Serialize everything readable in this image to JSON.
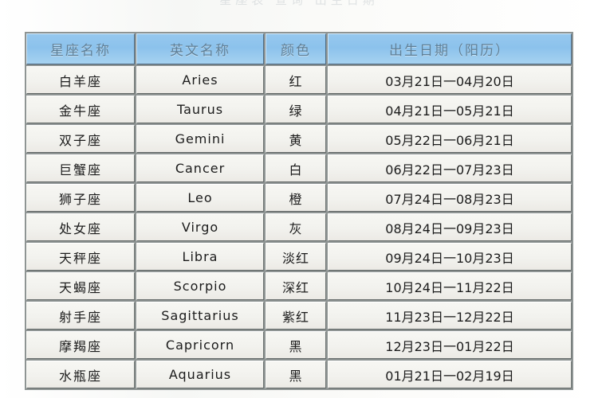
{
  "page": {
    "top_faint_text": "星座表 查询 出生日期"
  },
  "table": {
    "headers": [
      "星座名称",
      "英文名称",
      "颜色",
      "出生日期（阳历）"
    ],
    "rows": [
      {
        "name": "白羊座",
        "english": "Aries",
        "color": "红",
        "dates": "03月21日一04月20日"
      },
      {
        "name": "金牛座",
        "english": "Taurus",
        "color": "绿",
        "dates": "04月21日一05月21日"
      },
      {
        "name": "双子座",
        "english": "Gemini",
        "color": "黄",
        "dates": "05月22日一06月21日"
      },
      {
        "name": "巨蟹座",
        "english": "Cancer",
        "color": "白",
        "dates": "06月22日一07月23日"
      },
      {
        "name": "狮子座",
        "english": "Leo",
        "color": "橙",
        "dates": "07月24日一08月23日"
      },
      {
        "name": "处女座",
        "english": "Virgo",
        "color": "灰",
        "dates": "08月24日一09月23日"
      },
      {
        "name": "天秤座",
        "english": "Libra",
        "color": "淡红",
        "dates": "09月24日一10月23日"
      },
      {
        "name": "天蝎座",
        "english": "Scorpio",
        "color": "深红",
        "dates": "10月24日一11月22日"
      },
      {
        "name": "射手座",
        "english": "Sagittarius",
        "color": "紫红",
        "dates": "11月23日一12月22日"
      },
      {
        "name": "摩羯座",
        "english": "Capricorn",
        "color": "黑",
        "dates": "12月23日一01月22日"
      },
      {
        "name": "水瓶座",
        "english": "Aquarius",
        "color": "黑",
        "dates": "01月21日一02月19日"
      }
    ]
  },
  "colors": {
    "header_blue": "#8cc2ec",
    "header_text": "#5f7f96",
    "row_bg": "#f2f2ee",
    "grid_line": "#6f7573",
    "page_bg": "#fbfbf9"
  }
}
